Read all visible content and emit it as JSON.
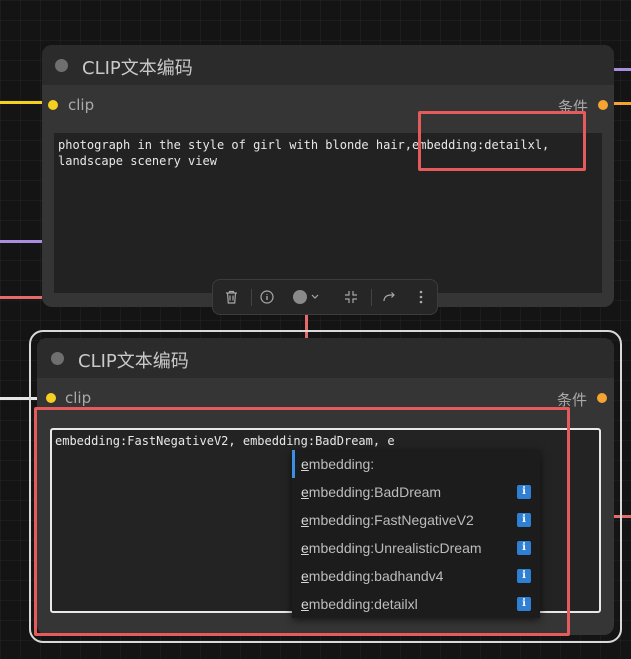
{
  "node_top": {
    "title": "CLIP文本编码",
    "input_label": "clip",
    "output_label": "条件",
    "text": "photograph in the style of girl with blonde hair,embedding:detailxl,\nlandscape scenery view"
  },
  "node_bottom": {
    "title": "CLIP文本编码",
    "input_label": "clip",
    "output_label": "条件",
    "text": "embedding:FastNegativeV2, embedding:BadDream, e"
  },
  "toolbar": {
    "delete_icon": "trash-icon",
    "info_icon": "info-icon",
    "color_icon": "color-circle-icon",
    "collapse_icon": "collapse-icon",
    "redo_icon": "redo-arrow-icon",
    "more_icon": "more-vertical-icon"
  },
  "autocomplete": {
    "typed_prefix": "e",
    "items": [
      {
        "rest": "mbedding:",
        "has_info": false
      },
      {
        "rest": "mbedding:BadDream",
        "has_info": true
      },
      {
        "rest": "mbedding:FastNegativeV2",
        "has_info": true
      },
      {
        "rest": "mbedding:UnrealisticDream",
        "has_info": true
      },
      {
        "rest": "mbedding:badhandv4",
        "has_info": true
      },
      {
        "rest": "mbedding:detailxl",
        "has_info": true
      }
    ],
    "info_glyph": "i"
  },
  "colors": {
    "clip_slot": "#f5d020",
    "conditioning_slot": "#f5a431",
    "highlight": "#e55b5b",
    "wire_purple": "#a98ee0",
    "wire_red": "#e56b6b"
  }
}
